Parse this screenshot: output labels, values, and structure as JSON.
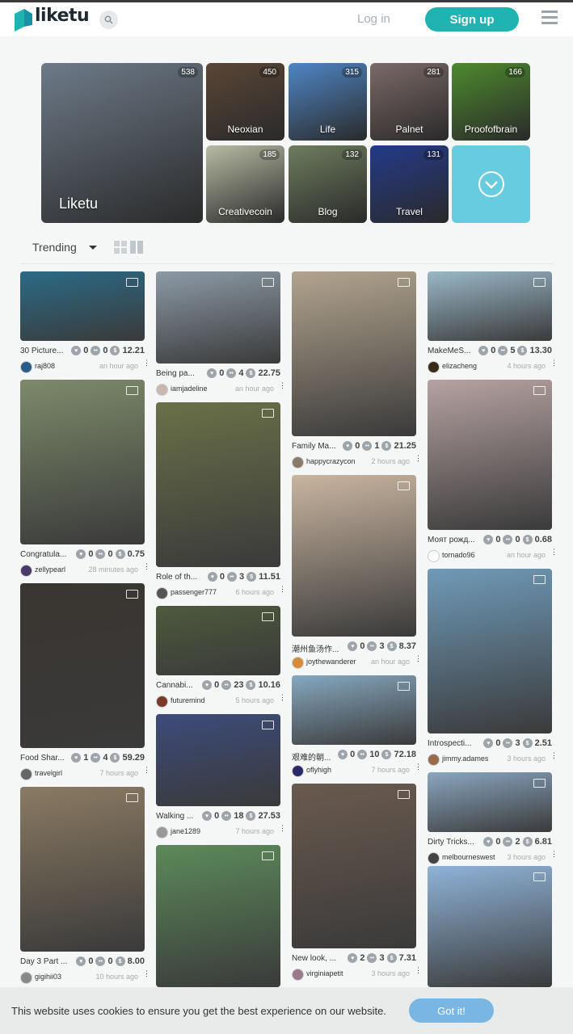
{
  "header": {
    "logo_text": "liketu",
    "login_label": "Log in",
    "signup_label": "Sign up"
  },
  "communities": [
    {
      "name": "Liketu",
      "count": "538",
      "color": "#6d7a88"
    },
    {
      "name": "Neoxian",
      "count": "450",
      "color": "#5a4636"
    },
    {
      "name": "Life",
      "count": "315",
      "color": "#4f86c6"
    },
    {
      "name": "Palnet",
      "count": "281",
      "color": "#7b6a68"
    },
    {
      "name": "Proofofbrain",
      "count": "166",
      "color": "#4d8a2e"
    },
    {
      "name": "Creativecoin",
      "count": "185",
      "color": "#b8bba4"
    },
    {
      "name": "Blog",
      "count": "132",
      "color": "#6e7d5e"
    },
    {
      "name": "Travel",
      "count": "131",
      "color": "#233a8a"
    }
  ],
  "toolbar": {
    "sort_label": "Trending"
  },
  "posts": [
    {
      "title": "30 Picture...",
      "likes": "0",
      "comments": "0",
      "payout": "12.21",
      "user": "raj808",
      "time": "an hour ago",
      "color": "#2b6a86",
      "avatar": "#2a5c8a"
    },
    {
      "title": "Congratula...",
      "likes": "0",
      "comments": "0",
      "payout": "0.75",
      "user": "zellypearl",
      "time": "28 minutes ago",
      "color": "#7d8a6a",
      "avatar": "#4a3a6a"
    },
    {
      "title": "Food Shar...",
      "likes": "1",
      "comments": "4",
      "payout": "59.29",
      "user": "travelgirl",
      "time": "7 hours ago",
      "color": "#3a3530",
      "avatar": "#666666"
    },
    {
      "title": "Day 3 Part ...",
      "likes": "0",
      "comments": "0",
      "payout": "8.00",
      "user": "gigihii03",
      "time": "10 hours ago",
      "color": "#8a7a62",
      "avatar": "#888888"
    },
    {
      "title": "Being pa...",
      "likes": "0",
      "comments": "4",
      "payout": "22.75",
      "user": "iamjadeline",
      "time": "an hour ago",
      "color": "#8c9aa6",
      "avatar": "#c9b8b0"
    },
    {
      "title": "Role of th...",
      "likes": "0",
      "comments": "3",
      "payout": "11.51",
      "user": "passenger777",
      "time": "6 hours ago",
      "color": "#6a7048",
      "avatar": "#555555"
    },
    {
      "title": "Cannabi...",
      "likes": "0",
      "comments": "23",
      "payout": "10.16",
      "user": "futuremind",
      "time": "5 hours ago",
      "color": "#4e5a3c",
      "avatar": "#7a3a2a"
    },
    {
      "title": "Walking ...",
      "likes": "0",
      "comments": "18",
      "payout": "27.53",
      "user": "jane1289",
      "time": "7 hours ago",
      "color": "#3c4b7a",
      "avatar": "#999999"
    },
    {
      "title": "",
      "likes": "",
      "comments": "",
      "payout": "",
      "user": "",
      "time": "",
      "color": "#5c8a5a",
      "avatar": ""
    },
    {
      "title": "Family Ma...",
      "likes": "0",
      "comments": "1",
      "payout": "21.25",
      "user": "happycrazycon",
      "time": "2 hours ago",
      "color": "#b2a48e",
      "avatar": "#8a7a6a"
    },
    {
      "title": "潮州鱼汤作...",
      "likes": "0",
      "comments": "3",
      "payout": "8.37",
      "user": "joythewanderer",
      "time": "an hour ago",
      "color": "#c9b5a0",
      "avatar": "#d88a3a"
    },
    {
      "title": "艰难的朝...",
      "likes": "0",
      "comments": "10",
      "payout": "72.18",
      "user": "oflyhigh",
      "time": "7 hours ago",
      "color": "#86a8c0",
      "avatar": "#2a2a6a"
    },
    {
      "title": "New look, ...",
      "likes": "2",
      "comments": "3",
      "payout": "7.31",
      "user": "virginiapetit",
      "time": "3 hours ago",
      "color": "#6a5a4e",
      "avatar": "#9a7a8a"
    },
    {
      "title": "MakeMeS...",
      "likes": "0",
      "comments": "5",
      "payout": "13.30",
      "user": "elizacheng",
      "time": "4 hours ago",
      "color": "#9ab8c8",
      "avatar": "#3a2a1a"
    },
    {
      "title": "Моят рожд...",
      "likes": "0",
      "comments": "0",
      "payout": "0.68",
      "user": "tornado96",
      "time": "an hour ago",
      "color": "#b6a2a2",
      "avatar": "#ffffff"
    },
    {
      "title": "Introspecti...",
      "likes": "0",
      "comments": "3",
      "payout": "2.51",
      "user": "jimmy.adames",
      "time": "3 hours ago",
      "color": "#6f9ab8",
      "avatar": "#9a6a4a"
    },
    {
      "title": "Dirty Tricks...",
      "likes": "0",
      "comments": "2",
      "payout": "6.81",
      "user": "melbourneswest",
      "time": "3 hours ago",
      "color": "#8aa6c0",
      "avatar": "#444444"
    },
    {
      "title": "",
      "likes": "",
      "comments": "",
      "payout": "",
      "user": "",
      "time": "",
      "color": "#8fb3d8",
      "avatar": ""
    }
  ],
  "cookie": {
    "message": "This website uses cookies to ensure you get the best experience on our website.",
    "button_label": "Got it!"
  },
  "colors": {
    "brand": "#1fb4b1",
    "cookie_button": "#79b6e4",
    "more_tile": "#67cce0"
  }
}
